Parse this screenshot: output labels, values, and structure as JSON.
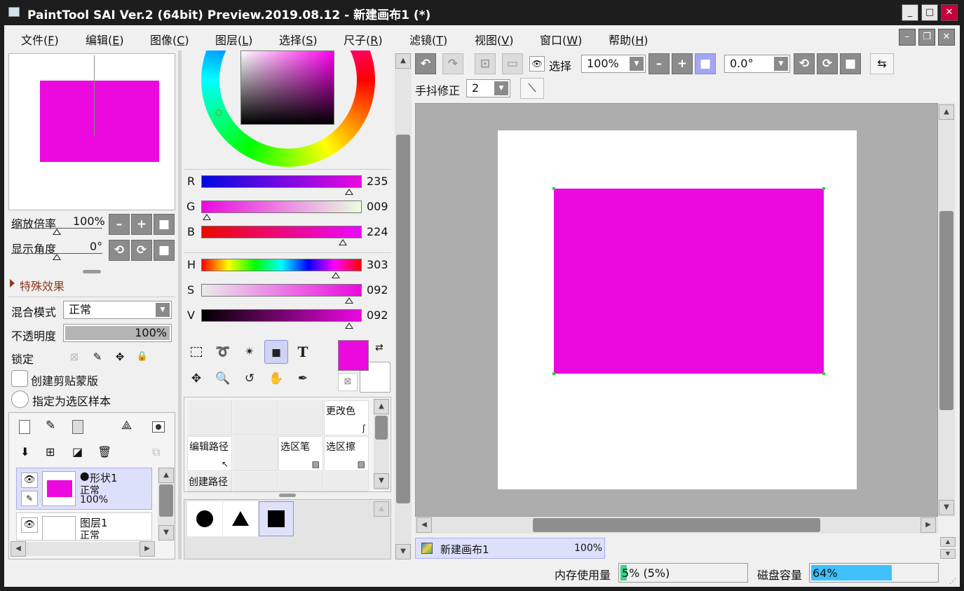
{
  "window": {
    "title": "PaintTool SAI Ver.2 (64bit) Preview.2019.08.12 - 新建画布1 (*)",
    "buttons": {
      "minimize": "_",
      "maximize": "□",
      "close": "✕"
    }
  },
  "menu": [
    {
      "label": "文件(",
      "key": "F",
      "end": ")"
    },
    {
      "label": "编辑(",
      "key": "E",
      "end": ")"
    },
    {
      "label": "图像(",
      "key": "C",
      "end": ")"
    },
    {
      "label": "图层(",
      "key": "L",
      "end": ")"
    },
    {
      "label": "选择(",
      "key": "S",
      "end": ")"
    },
    {
      "label": "尺子(",
      "key": "R",
      "end": ")"
    },
    {
      "label": "滤镜(",
      "key": "T",
      "end": ")"
    },
    {
      "label": "视图(",
      "key": "V",
      "end": ")"
    },
    {
      "label": "窗口(",
      "key": "W",
      "end": ")"
    },
    {
      "label": "帮助(",
      "key": "H",
      "end": ")"
    }
  ],
  "navigator": {
    "zoom_label": "缩放倍率",
    "zoom_value": "100%",
    "angle_label": "显示角度",
    "angle_value": "0°"
  },
  "effects": {
    "label": "特殊效果"
  },
  "layer_props": {
    "blend_label": "混合模式",
    "blend_value": "正常",
    "opacity_label": "不透明度",
    "opacity_value": "100%",
    "opacity_fraction": 1.0,
    "lock_label": "锁定",
    "clip_label": "创建剪贴蒙版",
    "selection_source_label": "指定为选区样本"
  },
  "layers": [
    {
      "name": "形状1",
      "mode": "正常",
      "opacity": "100%",
      "selected": true,
      "thumb_color": "#eb09e0"
    },
    {
      "name": "图层1",
      "mode": "正常",
      "opacity": "",
      "selected": false,
      "thumb_color": "#ffffff"
    }
  ],
  "color": {
    "current_hex": "#eb09e0",
    "rgb": [
      {
        "label": "R",
        "value": "235",
        "fraction": 0.92
      },
      {
        "label": "G",
        "value": "009",
        "fraction": 0.035
      },
      {
        "label": "B",
        "value": "224",
        "fraction": 0.88
      }
    ],
    "hsv": [
      {
        "label": "H",
        "value": "303",
        "fraction": 0.84
      },
      {
        "label": "S",
        "value": "092",
        "fraction": 0.92
      },
      {
        "label": "V",
        "value": "092",
        "fraction": 0.92
      }
    ]
  },
  "tools": [
    "selection-rect",
    "lasso",
    "magic-wand",
    "shape",
    "text",
    "move",
    "zoom",
    "rotate",
    "hand",
    "eyedropper"
  ],
  "tool_grid": {
    "change_color": "更改色",
    "edit_path": "编辑路径",
    "sel_pen": "选区笔",
    "sel_erase": "选区擦",
    "create_path": "创建路径"
  },
  "toolbar": {
    "select_label": "选择",
    "zoom_value": "100%",
    "angle_value": "0.0°",
    "stabilizer_label": "手抖修正",
    "stabilizer_value": "2"
  },
  "canvas_tab": {
    "name": "新建画布1",
    "zoom": "100%"
  },
  "status": {
    "memory_label": "内存使用量",
    "memory_value": "5% (5%)",
    "memory_fraction": 0.05,
    "disk_label": "磁盘容量",
    "disk_value": "64%",
    "disk_fraction": 0.64
  },
  "colors": {
    "shape": "#eb09e0",
    "accent": "#3fc1ff",
    "memory_fill": "#39d68a"
  }
}
